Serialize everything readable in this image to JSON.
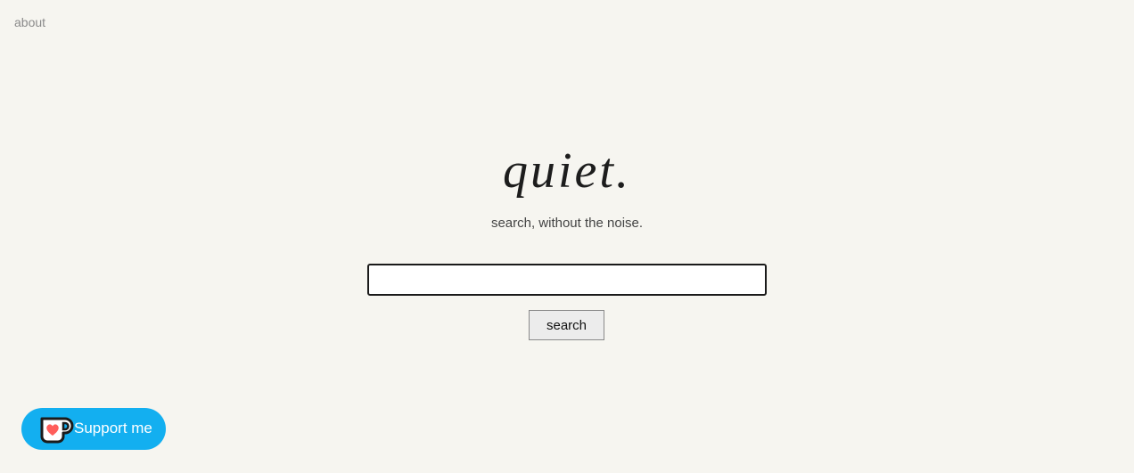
{
  "nav": {
    "about_label": "about"
  },
  "hero": {
    "logo_text": "quiet.",
    "tagline": "search, without the noise."
  },
  "search": {
    "input_value": "",
    "button_label": "search"
  },
  "support": {
    "label": "Support me",
    "icon": "kofi-cup-icon"
  },
  "colors": {
    "background": "#f6f5f0",
    "support_button": "#13aff0",
    "heart": "#ff5e5b"
  }
}
